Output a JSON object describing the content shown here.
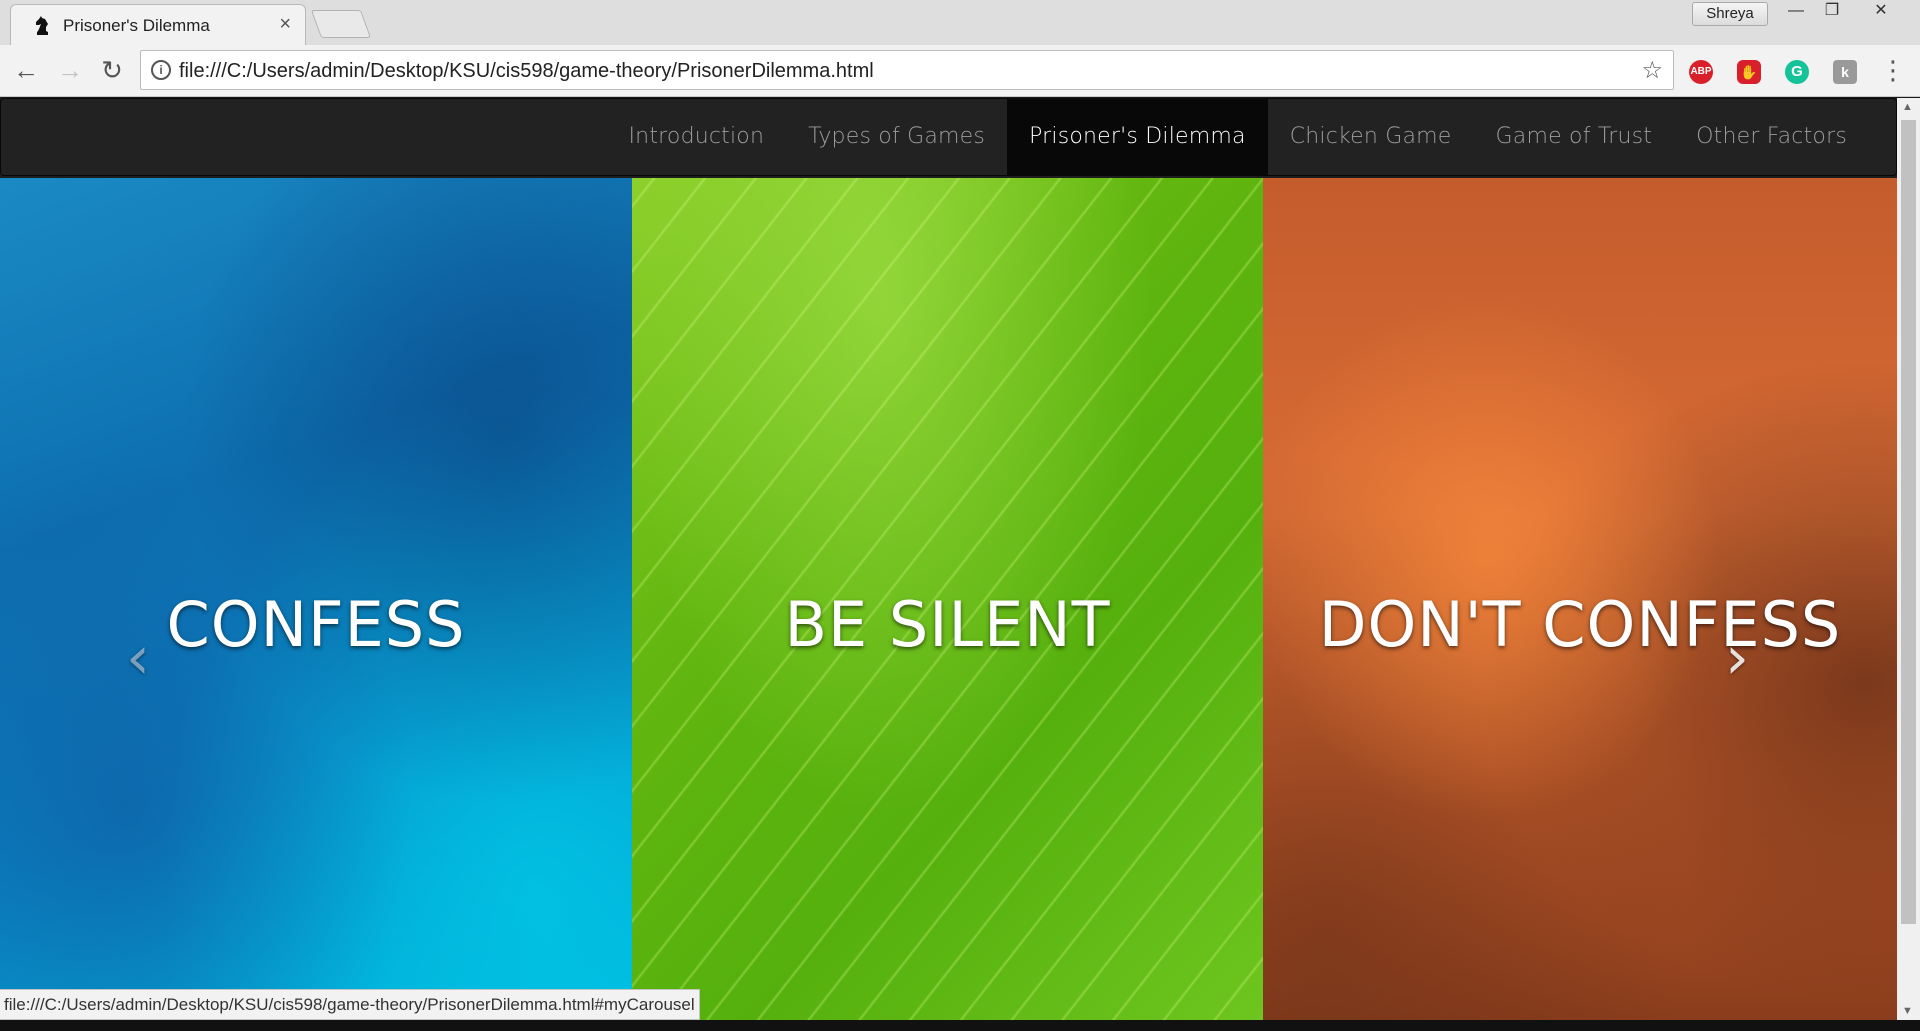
{
  "browser": {
    "tab_title": "Prisoner's Dilemma",
    "tab_close": "×",
    "profile_name": "Shreya",
    "url": "file:///C:/Users/admin/Desktop/KSU/cis598/game-theory/PrisonerDilemma.html",
    "status_url": "file:///C:/Users/admin/Desktop/KSU/cis598/game-theory/PrisonerDilemma.html#myCarousel",
    "extensions": [
      "ABP",
      "✋",
      "G",
      "k"
    ]
  },
  "navbar": {
    "items": [
      {
        "label": "Introduction",
        "active": false
      },
      {
        "label": "Types of Games",
        "active": false
      },
      {
        "label": "Prisoner's Dilemma",
        "active": true
      },
      {
        "label": "Chicken Game",
        "active": false
      },
      {
        "label": "Game of Trust",
        "active": false
      },
      {
        "label": "Other Factors",
        "active": false
      }
    ]
  },
  "carousel": {
    "panels": [
      {
        "label": "CONFESS",
        "color": "#0d6fb0"
      },
      {
        "label": "BE SILENT",
        "color": "#62b60f"
      },
      {
        "label": "DON'T CONFESS",
        "color": "#d86c35"
      }
    ],
    "prev_icon": "‹",
    "next_icon": "›"
  }
}
